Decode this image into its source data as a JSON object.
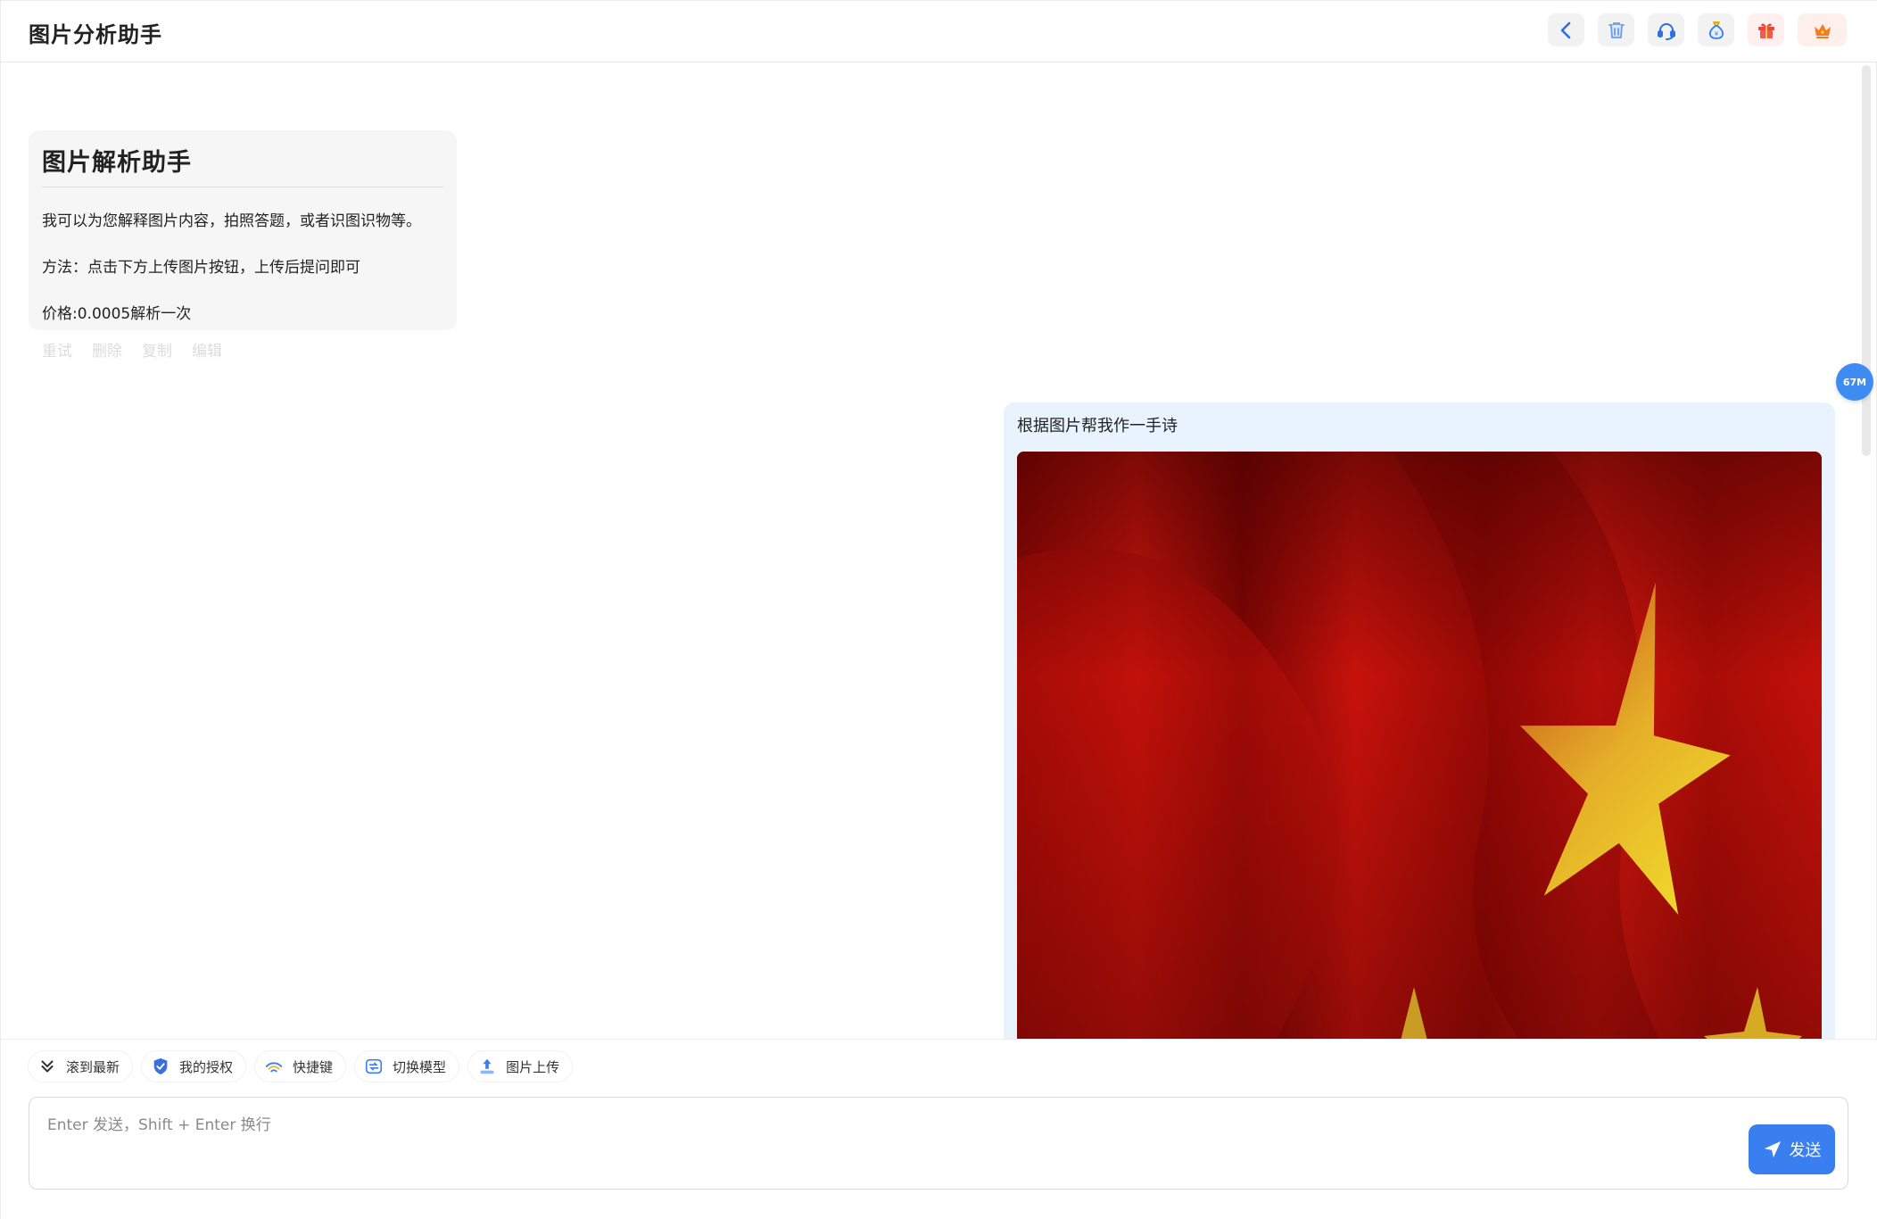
{
  "header": {
    "title": "图片分析助手",
    "buttons": [
      {
        "icon": "chevron-left-icon",
        "color": "#2f6fe0",
        "bg": "#f2f2f2"
      },
      {
        "icon": "trash-icon",
        "color": "#6b9bf0",
        "bg": "#f2f2f2"
      },
      {
        "icon": "headset-icon",
        "color": "#2f6fe0",
        "bg": "#f2f2f2"
      },
      {
        "icon": "money-bag-icon",
        "color": "#3a7ff0",
        "bg": "#f2f2f2"
      },
      {
        "icon": "gift-icon",
        "color": "#f0443c",
        "bg": "#fdf0ef"
      },
      {
        "icon": "crown-icon",
        "color": "#f47c1c",
        "bg": "#fdf0ea"
      }
    ]
  },
  "memory_badge": "67M",
  "bot_message": {
    "title": "图片解析助手",
    "lines": [
      "我可以为您解释图片内容，拍照答题，或者识图识物等。",
      "方法：点击下方上传图片按钮，上传后提问即可",
      "价格:0.0005解析一次"
    ],
    "actions": [
      "重试",
      "删除",
      "复制",
      "编辑"
    ]
  },
  "user_message": {
    "text": "根据图片帮我作一手诗"
  },
  "toolbar": {
    "items": [
      {
        "icon": "chevrons-down-icon",
        "label": "滚到最新"
      },
      {
        "icon": "shield-check-icon",
        "label": "我的授权"
      },
      {
        "icon": "wifi-signal-icon",
        "label": "快捷键"
      },
      {
        "icon": "switch-model-icon",
        "label": "切换模型"
      },
      {
        "icon": "upload-icon",
        "label": "图片上传"
      }
    ]
  },
  "input": {
    "placeholder": "Enter 发送，Shift + Enter 换行",
    "value": ""
  },
  "send_button": {
    "label": "发送"
  },
  "colors": {
    "accent": "#3a7ff0",
    "user_bubble": "#e8f3fe",
    "bot_bubble": "#f6f6f6",
    "flag_red": "#c8130d",
    "flag_yellow": "#f3e22a"
  }
}
